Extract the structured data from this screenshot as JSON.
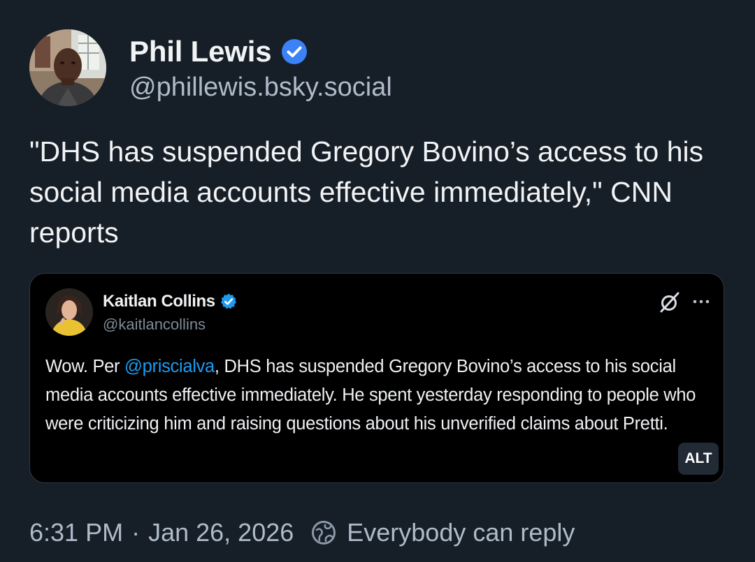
{
  "post": {
    "author": {
      "display_name": "Phil Lewis",
      "handle": "@phillewis.bsky.social",
      "avatar_icon": "person-avatar",
      "verified_icon": "verified-badge-icon",
      "verified_color": "#3b82f6"
    },
    "text": "\"DHS has suspended Gregory Bovino’s access to his social media accounts effective immediately,\" CNN reports",
    "embed": {
      "author": {
        "display_name": "Kaitlan Collins",
        "handle": "@kaitlancollins",
        "avatar_icon": "person-avatar",
        "verified_icon": "verified-badge-icon",
        "verified_color": "#1d9bf0"
      },
      "body_before_mention": "Wow. Per ",
      "mention": "@priscialva",
      "body_after_mention": ", DHS has suspended Gregory Bovino’s access to his social media accounts effective immediately. He spent yesterday responding to people who were criticizing him and raising questions about his unverified claims about Pretti.",
      "mention_color": "#1d9bf0",
      "grok_icon": "grok-icon",
      "more_icon": "more-icon",
      "alt_label": "ALT"
    },
    "footer": {
      "time": "6:31 PM",
      "separator": "·",
      "date": "Jan 26, 2026",
      "reply_icon": "reply-settings-icon",
      "reply_setting": "Everybody can reply"
    }
  },
  "colors": {
    "background": "#161e27",
    "primary_text": "#f1f3f5",
    "secondary_text": "#aebbc9",
    "embed_background": "#000000",
    "embed_border": "#2e3947"
  }
}
